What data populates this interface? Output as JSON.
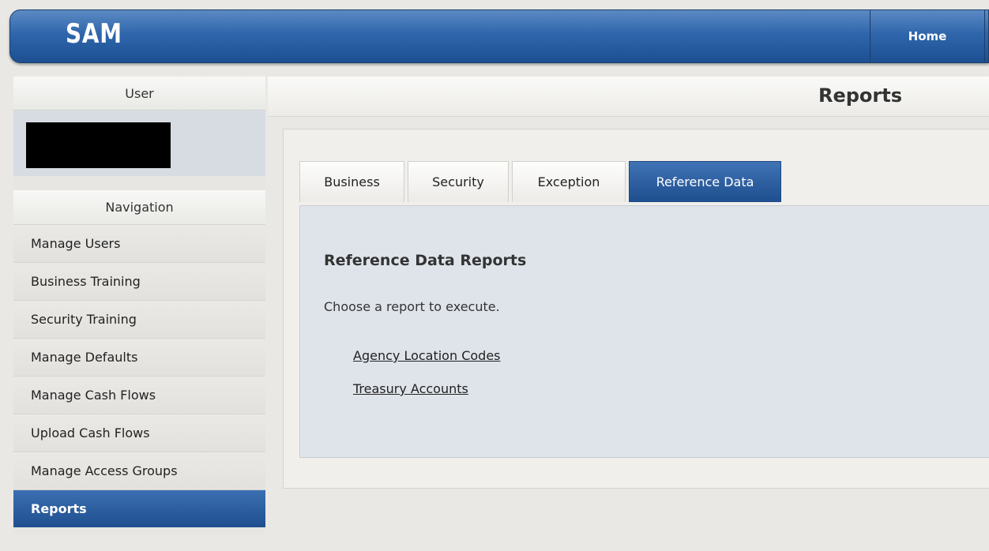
{
  "header": {
    "logo": "SAM",
    "home_label": "Home"
  },
  "sidebar": {
    "user_heading": "User",
    "nav_heading": "Navigation",
    "items": [
      {
        "label": "Manage Users"
      },
      {
        "label": "Business Training"
      },
      {
        "label": "Security Training"
      },
      {
        "label": "Manage Defaults"
      },
      {
        "label": "Manage Cash Flows"
      },
      {
        "label": "Upload Cash Flows"
      },
      {
        "label": "Manage Access Groups"
      },
      {
        "label": "Reports",
        "active": true
      }
    ]
  },
  "main": {
    "title": "Reports",
    "tabs": [
      {
        "label": "Business"
      },
      {
        "label": "Security"
      },
      {
        "label": "Exception"
      },
      {
        "label": "Reference Data",
        "active": true
      }
    ],
    "section_title": "Reference Data Reports",
    "instruction": "Choose a report to execute.",
    "links": [
      {
        "label": "Agency Location Codes"
      },
      {
        "label": "Treasury Accounts"
      }
    ]
  }
}
